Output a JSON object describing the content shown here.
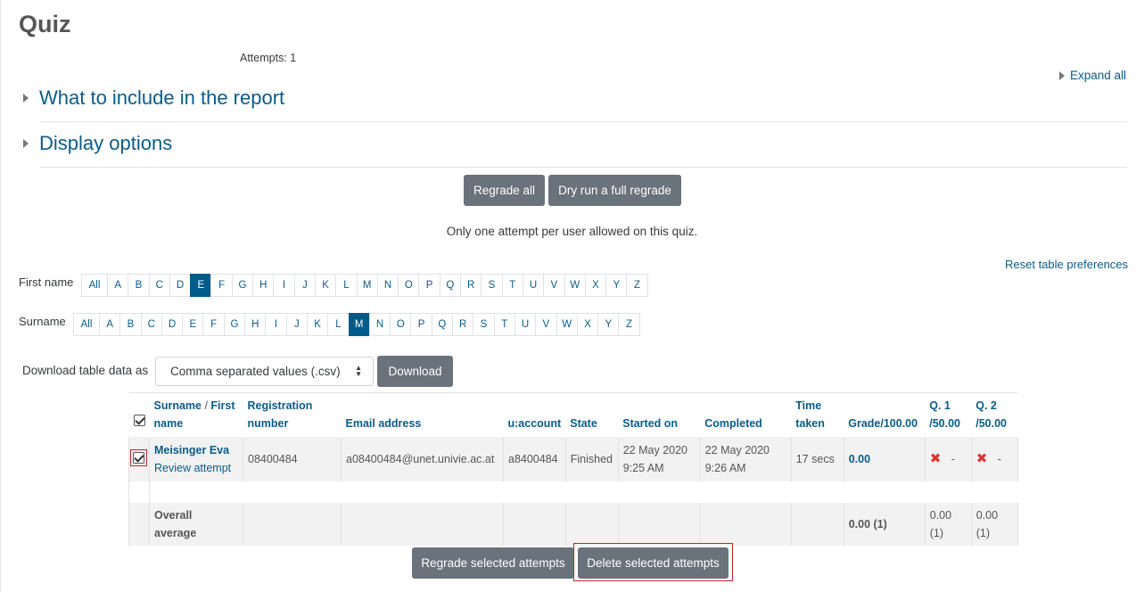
{
  "page": {
    "title": "Quiz",
    "attempts": "Attempts: 1",
    "expand_all": "Expand all"
  },
  "sections": {
    "include": "What to include in the report",
    "display": "Display options"
  },
  "buttons": {
    "regrade_all": "Regrade all",
    "dry_run": "Dry run a full regrade",
    "download": "Download",
    "regrade_selected": "Regrade selected attempts",
    "delete_selected": "Delete selected attempts"
  },
  "note": "Only one attempt per user allowed on this quiz.",
  "reset_preferences": "Reset table preferences",
  "filters": {
    "first_name": {
      "label": "First name",
      "all": "All",
      "active": "E"
    },
    "surname": {
      "label": "Surname",
      "all": "All",
      "active": "M"
    },
    "letters": [
      "A",
      "B",
      "C",
      "D",
      "E",
      "F",
      "G",
      "H",
      "I",
      "J",
      "K",
      "L",
      "M",
      "N",
      "O",
      "P",
      "Q",
      "R",
      "S",
      "T",
      "U",
      "V",
      "W",
      "X",
      "Y",
      "Z"
    ]
  },
  "download": {
    "label": "Download table data as",
    "format": "Comma separated values (.csv)"
  },
  "table": {
    "headers": {
      "surname": "Surname",
      "sep": " / ",
      "first_name": "First name",
      "registration": "Registration number",
      "email": "Email address",
      "uaccount": "u:account",
      "state": "State",
      "started": "Started on",
      "completed": "Completed",
      "time_taken": "Time taken",
      "grade": "Grade/100.00",
      "q1_a": "Q. 1",
      "q1_b": "/50.00",
      "q2_a": "Q. 2",
      "q2_b": "/50.00"
    },
    "row": {
      "name": "Meisinger Eva",
      "review": "Review attempt",
      "registration": "08400484",
      "email": "a08400484@unet.univie.ac.at",
      "uaccount": "a8400484",
      "state": "Finished",
      "started_date": "22 May 2020",
      "started_time": "9:25 AM",
      "completed_date": "22 May 2020",
      "completed_time": "9:26 AM",
      "time_taken": "17 secs",
      "grade": "0.00",
      "q1": "-",
      "q2": "-"
    },
    "average": {
      "label_a": "Overall",
      "label_b": "average",
      "grade": "0.00 (1)",
      "q1": "0.00 (1)",
      "q2": "0.00 (1)"
    }
  },
  "colors": {
    "link": "#0a5c8a",
    "button": "#6a737b",
    "active_letter": "#005a8a",
    "highlight": "#c0262e"
  }
}
